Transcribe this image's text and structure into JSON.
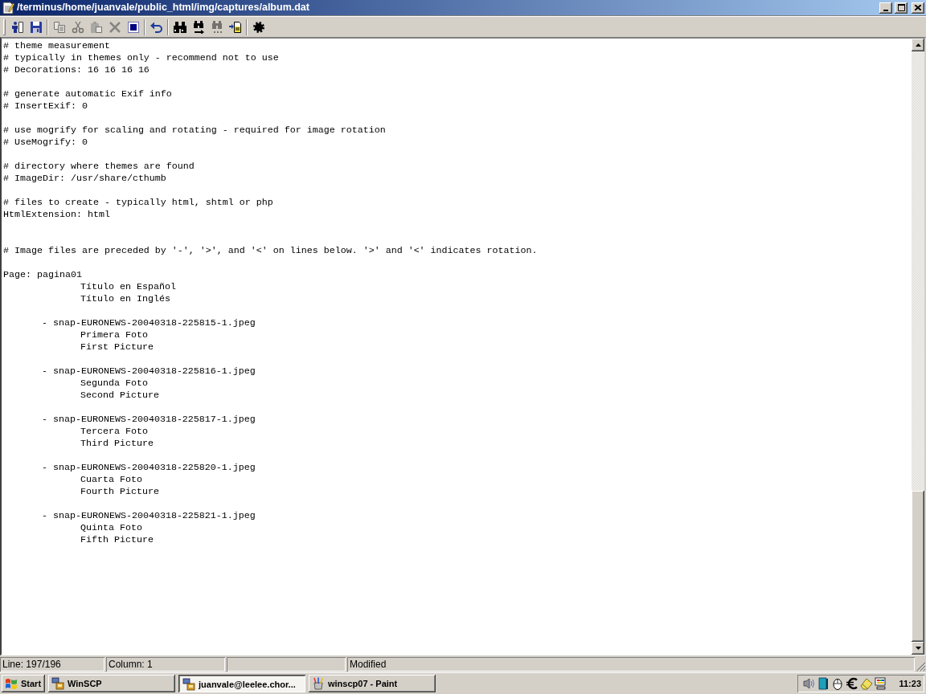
{
  "window": {
    "title": "/terminus/home/juanvale/public_html/img/captures/album.dat"
  },
  "toolbar": {
    "groups": [
      [
        {
          "disabled": false
        },
        {
          "disabled": false
        }
      ],
      [
        {
          "disabled": true
        },
        {
          "disabled": true
        },
        {
          "disabled": true
        },
        {
          "disabled": true
        },
        {
          "disabled": false
        }
      ],
      [
        {
          "disabled": false
        }
      ],
      [
        {
          "disabled": false
        },
        {
          "disabled": false
        },
        {
          "disabled": true
        },
        {
          "disabled": false
        }
      ],
      [
        {
          "disabled": false
        }
      ]
    ]
  },
  "editor": {
    "lines": [
      {
        "kind": "text",
        "text": "# theme measurement"
      },
      {
        "kind": "text",
        "text": "# typically in themes only - recommend not to use"
      },
      {
        "kind": "text",
        "text": "# Decorations: 16 16 16 16"
      },
      {
        "kind": "blank"
      },
      {
        "kind": "text",
        "text": "# generate automatic Exif info"
      },
      {
        "kind": "text",
        "text": "# InsertExif: 0"
      },
      {
        "kind": "blank"
      },
      {
        "kind": "text",
        "text": "# use mogrify for scaling and rotating - required for image rotation"
      },
      {
        "kind": "text",
        "text": "# UseMogrify: 0"
      },
      {
        "kind": "blank"
      },
      {
        "kind": "text",
        "text": "# directory where themes are found"
      },
      {
        "kind": "text",
        "text": "# ImageDir: /usr/share/cthumb"
      },
      {
        "kind": "blank"
      },
      {
        "kind": "text",
        "text": "# files to create - typically html, shtml or php"
      },
      {
        "kind": "text",
        "text": "HtmlExtension: html"
      },
      {
        "kind": "blank"
      },
      {
        "kind": "blank"
      },
      {
        "kind": "text",
        "text": "# Image files are preceded by '-', '>', and '<' on lines below. '>' and '<' indicates rotation."
      },
      {
        "kind": "blank"
      },
      {
        "kind": "text",
        "text": "Page: pagina01"
      },
      {
        "kind": "text",
        "text": "\t\tTítulo en Español"
      },
      {
        "kind": "text",
        "text": "\t\tTítulo en Inglés"
      },
      {
        "kind": "blank"
      },
      {
        "kind": "text",
        "text": "\t- snap-EURONEWS-20040318-225815-1.jpeg"
      },
      {
        "kind": "text",
        "text": "\t\tPrimera Foto"
      },
      {
        "kind": "text",
        "text": "\t\tFirst Picture"
      },
      {
        "kind": "blank"
      },
      {
        "kind": "text",
        "text": "\t- snap-EURONEWS-20040318-225816-1.jpeg"
      },
      {
        "kind": "text",
        "text": "\t\tSegunda Foto"
      },
      {
        "kind": "text",
        "text": "\t\tSecond Picture"
      },
      {
        "kind": "blank"
      },
      {
        "kind": "text",
        "text": "\t- snap-EURONEWS-20040318-225817-1.jpeg"
      },
      {
        "kind": "text",
        "text": "\t\tTercera Foto"
      },
      {
        "kind": "text",
        "text": "\t\tThird Picture"
      },
      {
        "kind": "blank"
      },
      {
        "kind": "text",
        "text": "\t- snap-EURONEWS-20040318-225820-1.jpeg"
      },
      {
        "kind": "text",
        "text": "\t\tCuarta Foto"
      },
      {
        "kind": "text",
        "text": "\t\tFourth Picture"
      },
      {
        "kind": "blank"
      },
      {
        "kind": "text",
        "text": "\t- snap-EURONEWS-20040318-225821-1.jpeg"
      },
      {
        "kind": "text",
        "text": "\t\tQuinta Foto"
      },
      {
        "kind": "text",
        "text": "\t\tFifth Picture"
      }
    ]
  },
  "status_bar": {
    "line": "Line: 197/196",
    "column": "Column: 1",
    "state": "Modified"
  },
  "taskbar": {
    "start": "Start",
    "buttons": [
      {
        "label": "WinSCP",
        "selected": false
      },
      {
        "label": "juanvale@leelee.chor...",
        "selected": true
      },
      {
        "label": "winscp07 - Paint",
        "selected": false
      }
    ],
    "clock": "11:23"
  }
}
